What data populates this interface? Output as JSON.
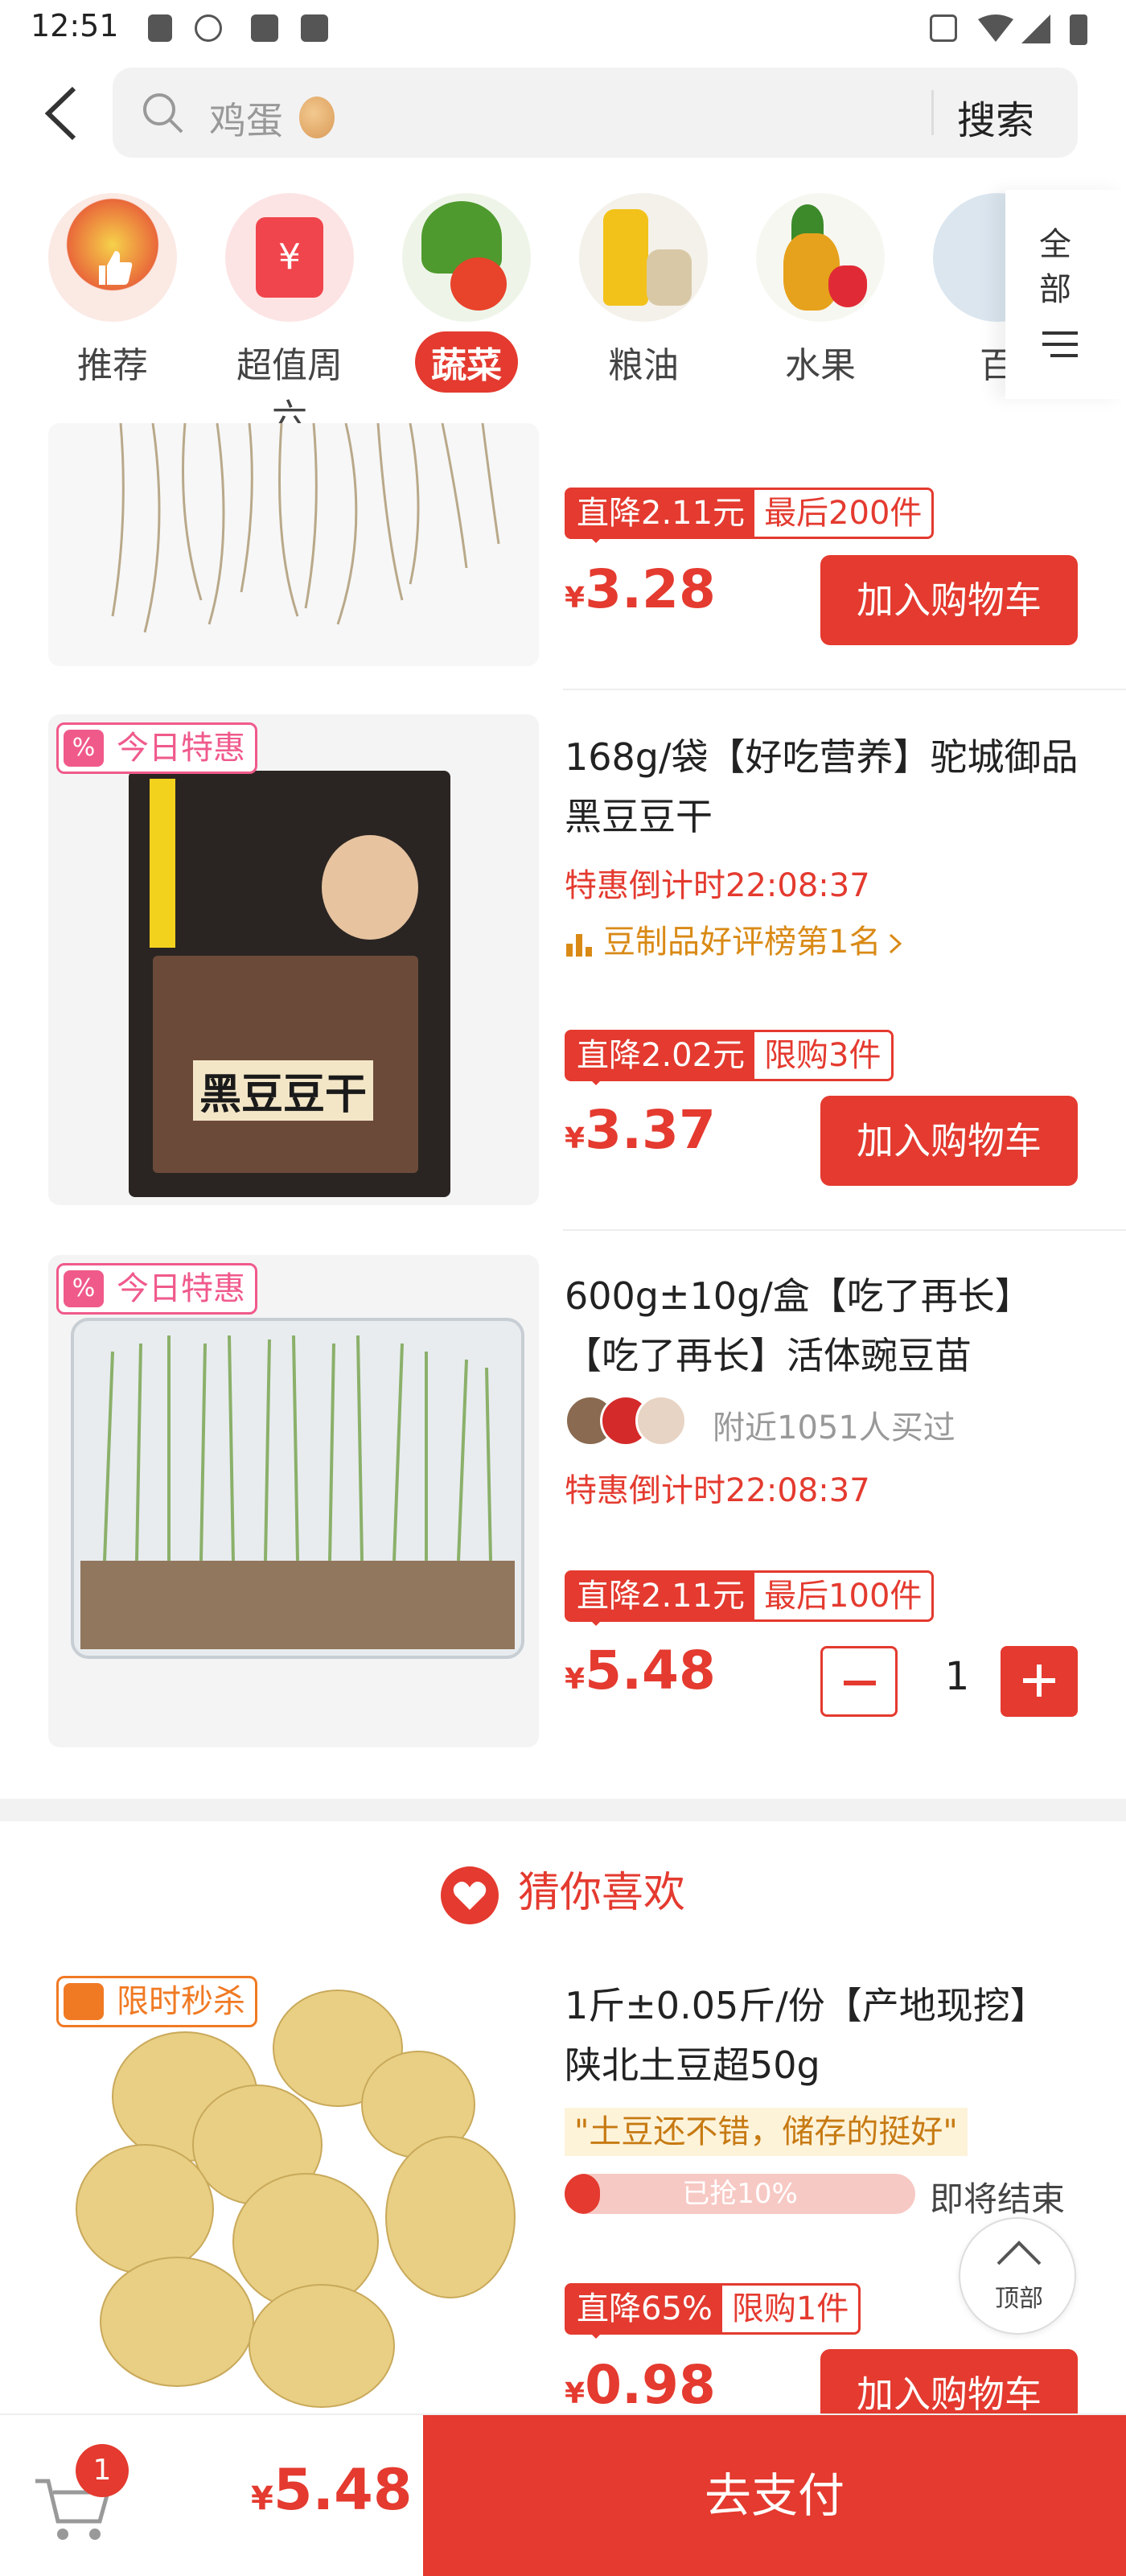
{
  "status_bar": {
    "time": "12:51"
  },
  "search": {
    "placeholder": "鸡蛋",
    "button_label": "搜索"
  },
  "categories": {
    "items": [
      {
        "label": "推荐"
      },
      {
        "label": "超值周六"
      },
      {
        "label": "蔬菜",
        "active": true
      },
      {
        "label": "粮油"
      },
      {
        "label": "水果"
      },
      {
        "label": "百"
      }
    ],
    "all_label": "全部"
  },
  "products": [
    {
      "promo_drop": "直降2.11元",
      "promo_limit": "最后200件",
      "price": "3.28",
      "cart_label": "加入购物车"
    },
    {
      "tag": "今日特惠",
      "title": "168g/袋【好吃营养】驼城御品黑豆豆干",
      "countdown": "特惠倒计时22:08:37",
      "rank": "豆制品好评榜第1名",
      "promo_drop": "直降2.02元",
      "promo_limit": "限购3件",
      "price": "3.37",
      "cart_label": "加入购物车",
      "package_text": "黑豆豆干"
    },
    {
      "tag": "今日特惠",
      "title": "600g±10g/盒【吃了再长】【吃了再长】活体豌豆苗",
      "buyers": "附近1051人买过",
      "countdown": "特惠倒计时22:08:37",
      "promo_drop": "直降2.11元",
      "promo_limit": "最后100件",
      "price": "5.48",
      "quantity": "1"
    }
  ],
  "guess_section": {
    "title": "猜你喜欢"
  },
  "recommend": {
    "tag": "限时秒杀",
    "title": "1斤±0.05斤/份【产地现挖】陕北土豆超50g",
    "quote": "\"土豆还不错，储存的挺好\"",
    "progress_text": "已抢10%",
    "progress_fraction": 0.1,
    "ending": "即将结束",
    "promo_drop": "直降65%",
    "promo_limit": "限购1件",
    "price": "0.98",
    "cart_label": "加入购物车"
  },
  "to_top_label": "顶部",
  "bottom_bar": {
    "cart_count": "1",
    "currency": "¥",
    "total": "5.48",
    "pay_label": "去支付"
  },
  "colors": {
    "accent": "#e43a2f",
    "today_tag": "#f05a8a",
    "flash_tag": "#f07a24",
    "rank": "#d98a16"
  }
}
